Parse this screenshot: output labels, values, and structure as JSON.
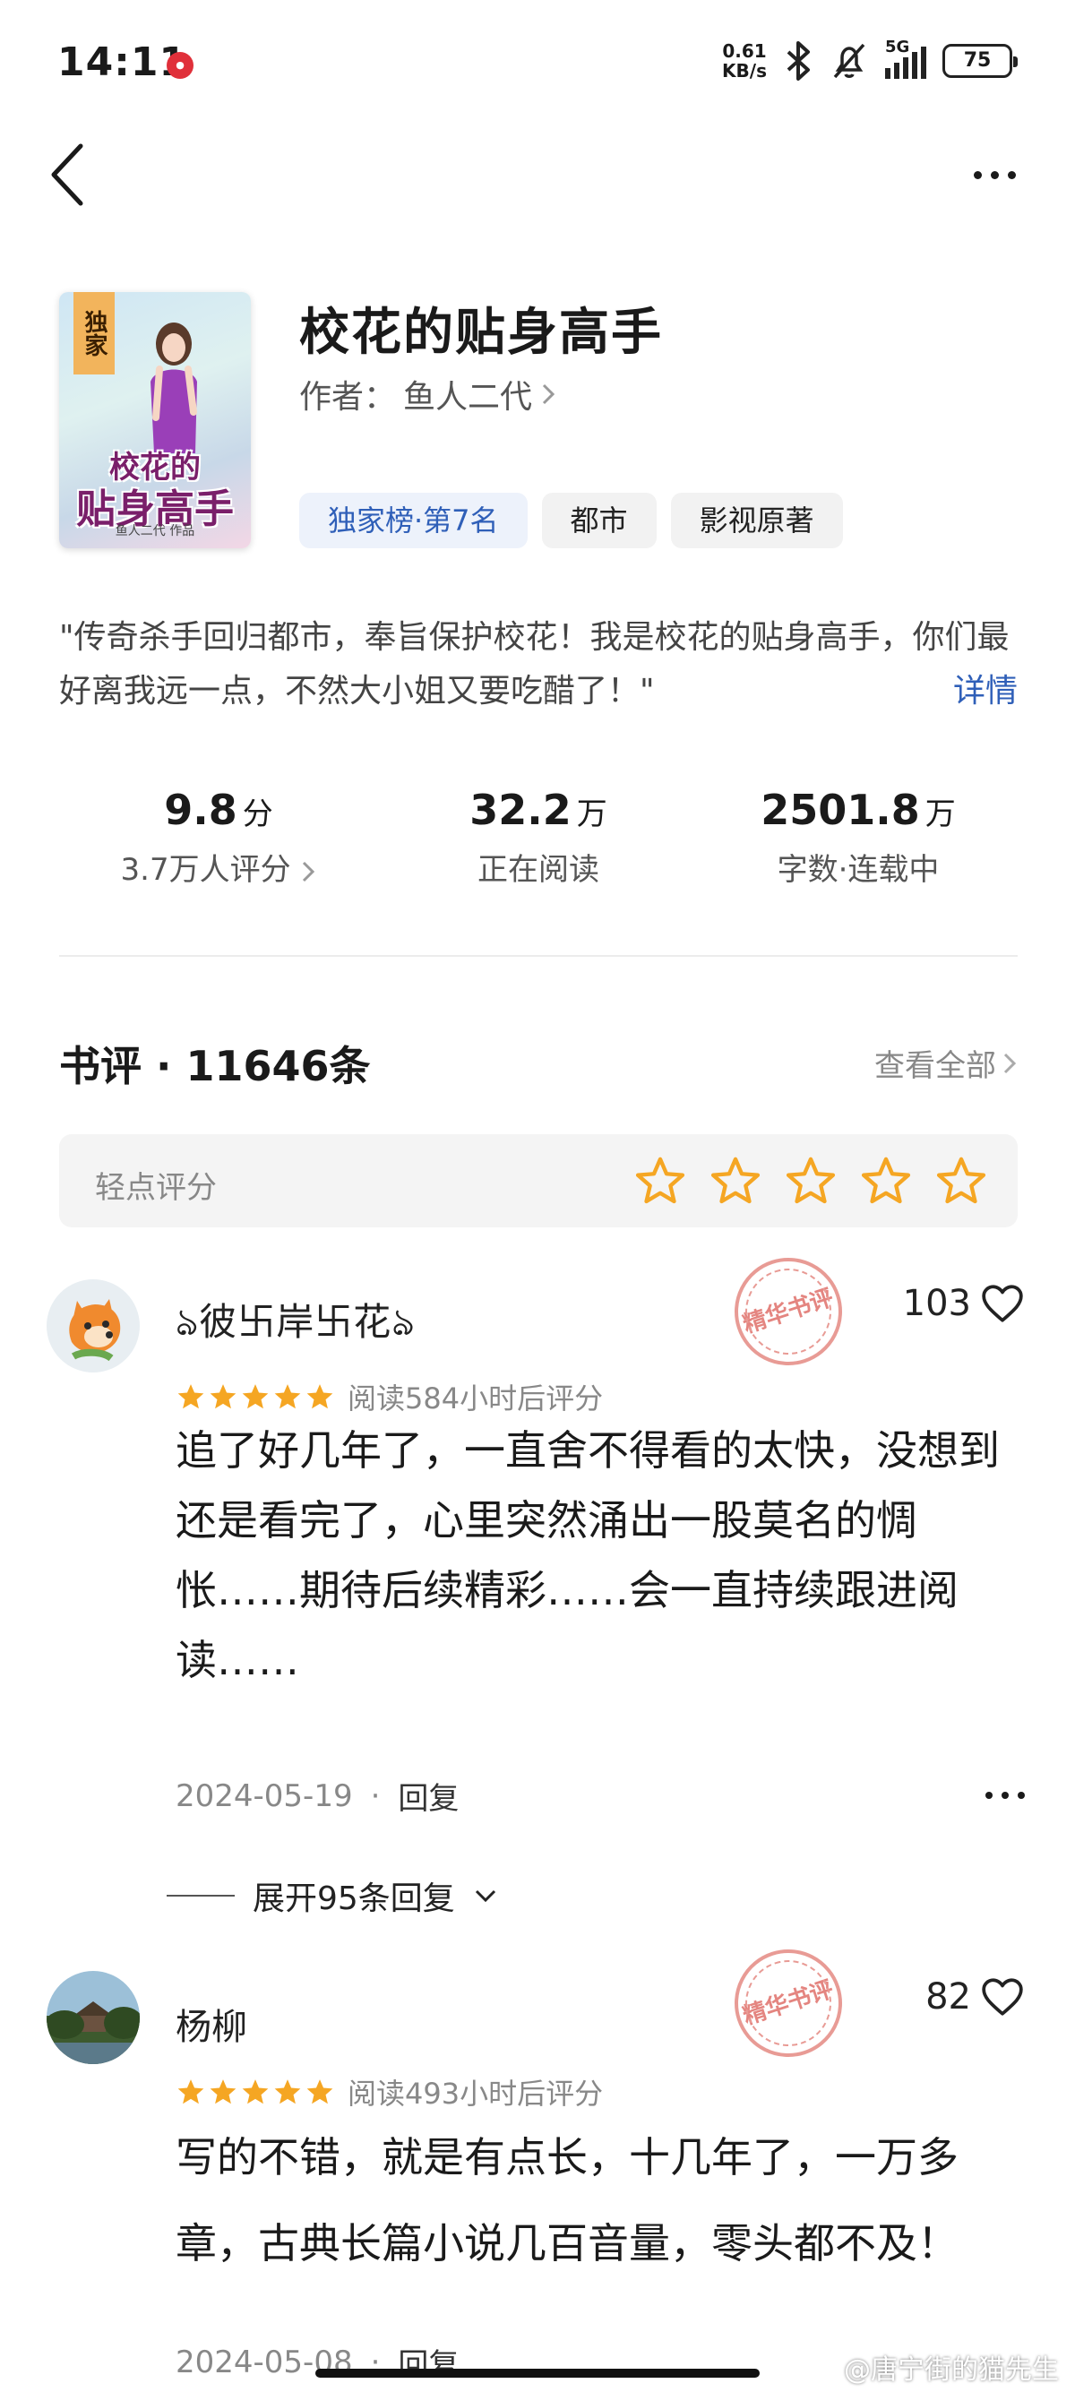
{
  "status_bar": {
    "time": "14:11",
    "notif_badge": "小红书",
    "net_speed_value": "0.61",
    "net_speed_unit": "KB/s",
    "signal_label": "5G",
    "battery": "75"
  },
  "book": {
    "title": "校花的贴身高手",
    "author_label": "作者：",
    "author_name": "鱼人二代",
    "cover": {
      "tag": "独家",
      "title_line1": "校花的",
      "title_line2": "贴身高手",
      "author": "鱼人二代 作品"
    },
    "tags": [
      "独家榜·第7名",
      "都市",
      "影视原著"
    ],
    "synopsis": "\"传奇杀手回归都市，奉旨保护校花！我是校花的贴身高手，你们最好离我远一点，不然大小姐又要吃醋了！\"",
    "synopsis_more": "详情"
  },
  "stats": [
    {
      "value": "9.8",
      "unit": "分",
      "label": "3.7万人评分"
    },
    {
      "value": "32.2",
      "unit": "万",
      "label": "正在阅读"
    },
    {
      "value": "2501.8",
      "unit": "万",
      "label": "字数·连载中"
    }
  ],
  "reviews_section": {
    "title": "书评 · 11646条",
    "view_all": "查看全部",
    "rate_prompt": "轻点评分",
    "rate_stars": 5
  },
  "reviews": [
    {
      "name": "彼卐岸卐花",
      "name_prefix": "ঌ",
      "name_suffix": "ঌ",
      "stamp": "精华书评",
      "likes": "103",
      "stars": 5,
      "read_hours": "阅读584小时后评分",
      "text": "追了好几年了，一直舍不得看的太快，没想到还是看完了，心里突然涌出一股莫名的惆怅……期待后续精彩……会一直持续跟进阅读……",
      "date": "2024-05-19",
      "dot": "·",
      "reply": "回复",
      "expand": "展开95条回复"
    },
    {
      "name": "杨柳",
      "stamp": "精华书评",
      "likes": "82",
      "stars": 5,
      "read_hours": "阅读493小时后评分",
      "text": "写的不错，就是有点长，十几年了，一万多章，古典长篇小说几百音量，零头都不及！",
      "date": "2024-05-08",
      "dot": "·",
      "reply": "回复"
    }
  ],
  "watermark": "@唐宁街的猫先生",
  "colors": {
    "accent_blue": "#2f5fb8",
    "star_orange": "#f5a623",
    "stamp_red": "#e0706a"
  }
}
